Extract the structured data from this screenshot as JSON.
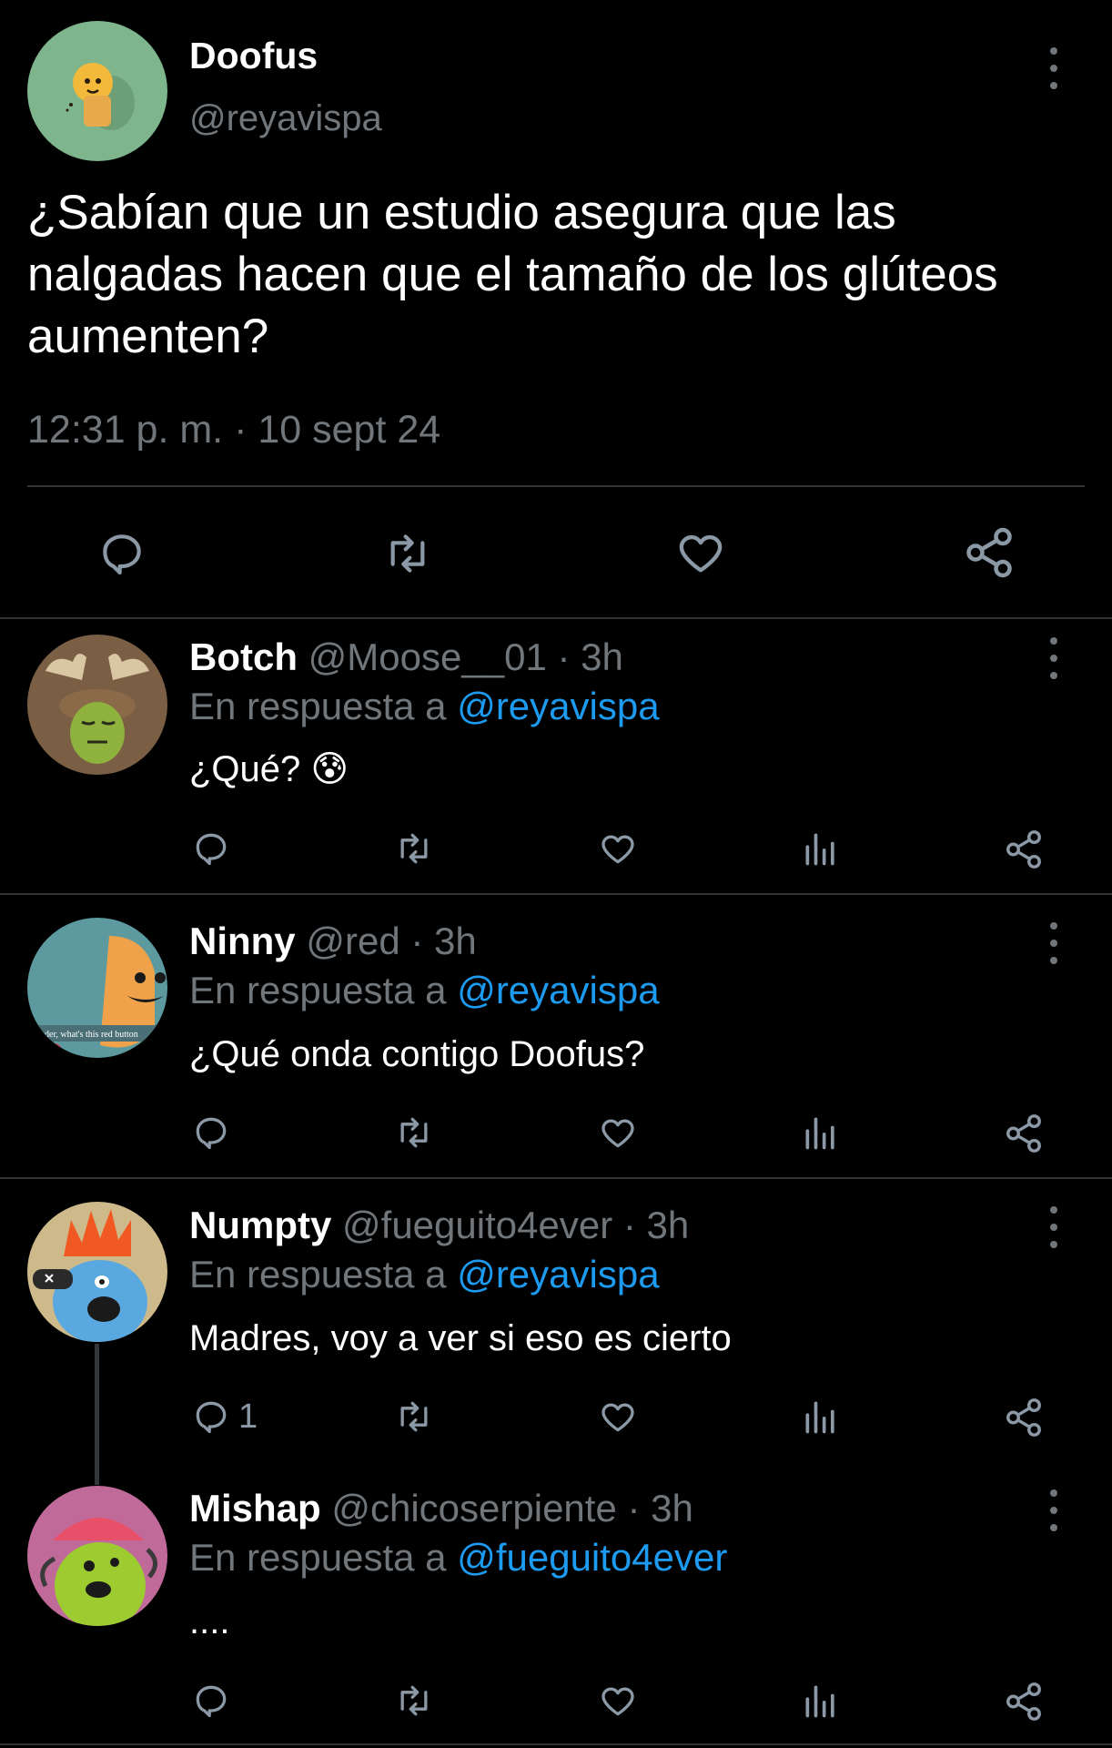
{
  "main_tweet": {
    "display_name": "Doofus",
    "handle": "@reyavispa",
    "text": "¿Sabían que un estudio asegura que las nalgadas hacen que el tamaño de los glúteos aumenten?",
    "timestamp": "12:31 p. m. · 10 sept 24",
    "actions": [
      "reply-icon",
      "retweet-icon",
      "like-icon",
      "share-icon"
    ]
  },
  "replies": [
    {
      "display_name": "Botch",
      "handle": "@Moose__01",
      "time": "· 3h",
      "reply_prefix": "En respuesta a",
      "reply_to": "@reyavispa",
      "text": "¿Qué?",
      "emoji": "😰",
      "reply_count": ""
    },
    {
      "display_name": "Ninny",
      "handle": "@red",
      "time": "· 3h",
      "reply_prefix": "En respuesta a",
      "reply_to": "@reyavispa",
      "text": "¿Qué onda contigo Doofus?",
      "emoji": "",
      "reply_count": "",
      "avatar_caption": "nder, what's this red button"
    },
    {
      "display_name": "Numpty",
      "handle": "@fueguito4ever",
      "time": "· 3h",
      "reply_prefix": "En respuesta a",
      "reply_to": "@reyavispa",
      "text": "Madres, voy a ver si eso es cierto",
      "emoji": "",
      "reply_count": "1"
    },
    {
      "display_name": "Mishap",
      "handle": "@chicoserpiente",
      "time": "· 3h",
      "reply_prefix": "En respuesta a",
      "reply_to": "@fueguito4ever",
      "text": "....",
      "emoji": "",
      "reply_count": ""
    }
  ],
  "colors": {
    "background": "#000000",
    "text": "#e7e9ea",
    "muted": "#71767b",
    "link": "#1d9bf0",
    "divider": "#2f3336"
  }
}
